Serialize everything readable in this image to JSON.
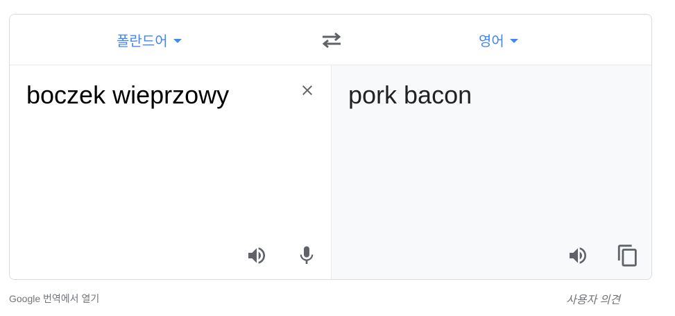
{
  "translator": {
    "source_lang": "폴란드어",
    "target_lang": "영어",
    "source_text": "boczek wieprzowy",
    "translated_text": "pork bacon"
  },
  "footer": {
    "open_link": "Google 번역에서 열기",
    "feedback_link": "사용자 의견"
  },
  "icons": {
    "swap": "swap-languages-icon",
    "clear": "close-icon",
    "speak_source": "speaker-icon",
    "mic": "microphone-icon",
    "speak_target": "speaker-icon",
    "copy": "copy-icon"
  },
  "colors": {
    "accent": "#4285f4",
    "icon": "#5f6368",
    "target_bg": "#f8f9fa",
    "border": "#dadce0"
  }
}
